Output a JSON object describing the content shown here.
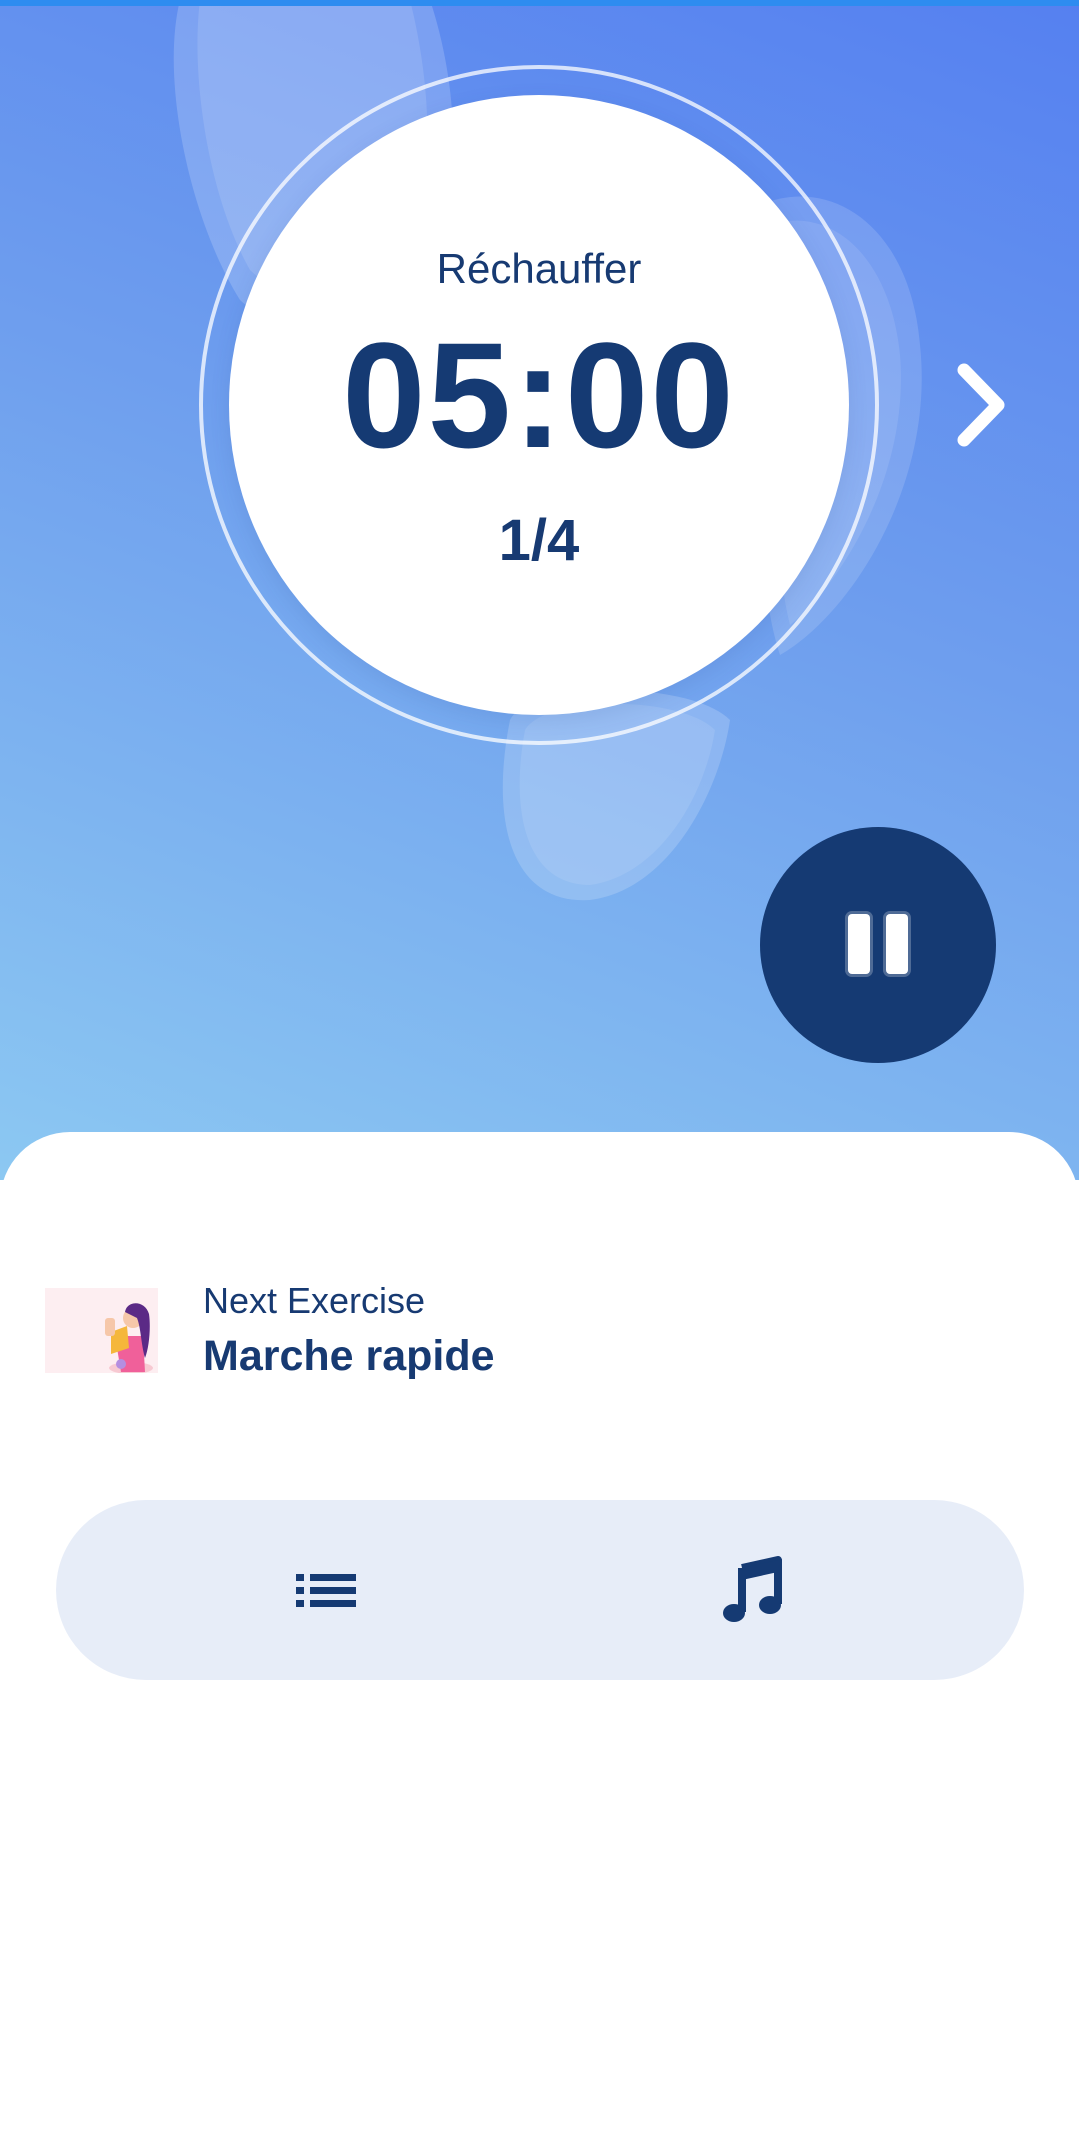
{
  "colors": {
    "navy": "#153a73",
    "hero_top": "#5580f0",
    "hero_bottom": "#8cc8f2",
    "control_bar_bg": "#e7edf8"
  },
  "timer": {
    "phase_label": "Réchauffer",
    "time": "05:00",
    "progress": "1/4",
    "next_icon": "chevron-right-icon",
    "pause_icon": "pause-icon"
  },
  "next_exercise": {
    "caption": "Next Exercise",
    "name": "Marche rapide"
  },
  "controls": {
    "list_icon": "list-icon",
    "music_icon": "music-note-icon"
  }
}
